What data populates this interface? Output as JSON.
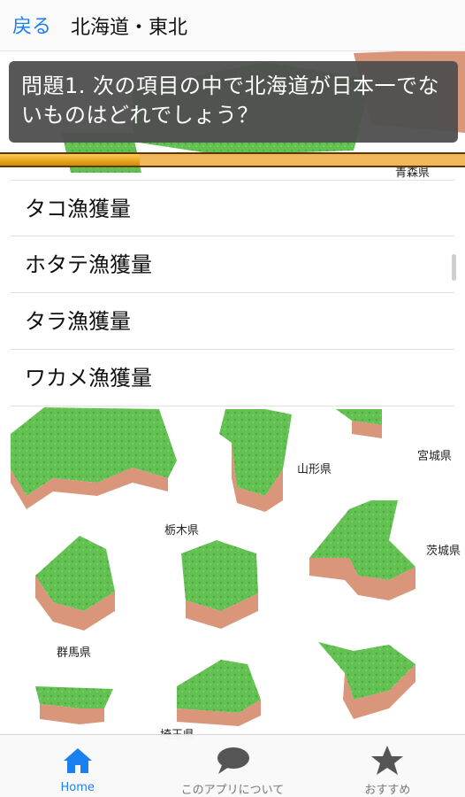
{
  "nav": {
    "back_label": "戻る",
    "title": "北海道・東北"
  },
  "question": {
    "text": "問題1. 次の項目の中で北海道が日本一でないものはどれでしょう？"
  },
  "progress": {
    "value": 0.3
  },
  "answers": [
    {
      "label": "タコ漁獲量"
    },
    {
      "label": "ホタテ漁獲量"
    },
    {
      "label": "タラ漁獲量"
    },
    {
      "label": "ワカメ漁獲量"
    }
  ],
  "map_labels": {
    "aomori": "青森県",
    "yamagata": "山形県",
    "miyagi": "宮城県",
    "tochigi": "栃木県",
    "ibaraki": "茨城県",
    "gunma": "群馬県",
    "saitama": "埼玉県"
  },
  "tabs": [
    {
      "label": "Home",
      "icon": "home-icon",
      "active": true
    },
    {
      "label": "このアプリについて",
      "icon": "speech-bubble-icon",
      "active": false
    },
    {
      "label": "おすすめ",
      "icon": "star-icon",
      "active": false
    }
  ],
  "colors": {
    "accent": "#1a7ff0",
    "grass": "#5fbf4f",
    "earth": "#d9967a",
    "progress": "#f0a020"
  }
}
